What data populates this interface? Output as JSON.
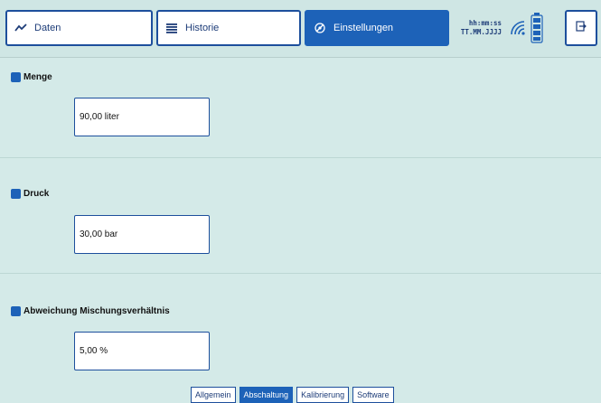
{
  "header": {
    "tabs": [
      {
        "label": "Daten",
        "icon": "trend-icon"
      },
      {
        "label": "Historie",
        "icon": "list-icon"
      },
      {
        "label": "Einstellungen",
        "icon": "settings-icon",
        "active": true
      }
    ],
    "time_placeholder": "hh:mm:ss",
    "date_placeholder": "TT.MM.JJJJ",
    "exit_icon": "exit-icon"
  },
  "settings": {
    "menge": {
      "label": "Menge",
      "value": "90,00 liter"
    },
    "druck": {
      "label": "Druck",
      "value": "30,00 bar"
    },
    "abweichung": {
      "label": "Abweichung Mischungsverhältnis",
      "value": "5,00 %"
    }
  },
  "subtabs": [
    {
      "label": "Allgemein",
      "active": false
    },
    {
      "label": "Abschaltung",
      "active": true
    },
    {
      "label": "Kalibrierung",
      "active": false
    },
    {
      "label": "Software",
      "active": false
    }
  ],
  "colors": {
    "accent": "#1d62b8",
    "background": "#d4eae8"
  }
}
